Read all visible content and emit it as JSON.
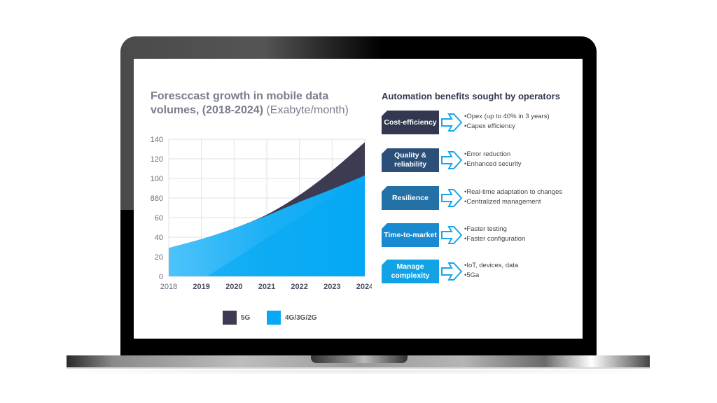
{
  "chart_title": {
    "main": "Foresccast growth in mobile data volumes, (2018-2024)",
    "unit": "(Exabyte/month)"
  },
  "chart_data": {
    "type": "area",
    "stacked": true,
    "title": "Forescast growth in mobile data volumes, (2018-2024) (Exabyte/month)",
    "xlabel": "",
    "ylabel": "",
    "x": [
      "2018",
      "2019",
      "2020",
      "2021",
      "2022",
      "2023",
      "2024"
    ],
    "ylim": [
      0,
      140
    ],
    "yticks": [
      "0",
      "20",
      "40",
      "60",
      "880",
      "100",
      "120",
      "140"
    ],
    "ytick_values": [
      0,
      20,
      40,
      60,
      80,
      100,
      120,
      140
    ],
    "grid": true,
    "legend": "bottom",
    "series": [
      {
        "name": "4G/3G/2G",
        "color": "#05a9f4",
        "values": [
          29,
          38,
          49,
          62,
          76,
          89,
          103
        ]
      },
      {
        "name": "5G",
        "color": "#3c3b52",
        "values": [
          0,
          0,
          0,
          1,
          7,
          19,
          34
        ]
      }
    ]
  },
  "legend": [
    {
      "label": "5G",
      "color": "#3c3b52"
    },
    {
      "label": "4G/3G/2G",
      "color": "#05a9f4"
    }
  ],
  "automation": {
    "title": "Automation benefits sought by operators",
    "items": [
      {
        "label": "Cost-efficiency",
        "color": "#333850",
        "bullets": [
          "•Opex (up to 40% in 3 years)",
          "•Capex efficiency"
        ]
      },
      {
        "label": "Quality & reliability",
        "color": "#2b4f78",
        "bullets": [
          "•Error reduction",
          "•Enhanced security"
        ]
      },
      {
        "label": "Resilience",
        "color": "#2471a8",
        "bullets": [
          "•Real-time adaptation to changes",
          "•Centralized management"
        ]
      },
      {
        "label": "Time-to-market",
        "color": "#1a8ad0",
        "bullets": [
          "•Faster testing",
          "•Faster configuration"
        ]
      },
      {
        "label": "Manage complexity",
        "color": "#12a2e6",
        "bullets": [
          "•IoT, devices, data",
          "•5Ga"
        ]
      }
    ],
    "arrow_color": "#1aa6ec"
  }
}
